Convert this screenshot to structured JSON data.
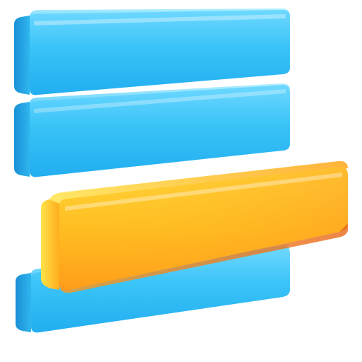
{
  "icon": {
    "name": "sorted-bars-icon",
    "bars": [
      {
        "id": "bar-1",
        "color_name": "blue",
        "highlighted": false
      },
      {
        "id": "bar-2",
        "color_name": "blue",
        "highlighted": false
      },
      {
        "id": "bar-3",
        "color_name": "orange",
        "highlighted": true
      },
      {
        "id": "bar-4",
        "color_name": "blue",
        "highlighted": false
      }
    ],
    "colors": {
      "blue_light": "#7fe0ff",
      "blue_main": "#2bbcf4",
      "blue_dark": "#1a90d8",
      "orange_light": "#ffe14a",
      "orange_main": "#ffb21e",
      "orange_dark": "#f07a14"
    }
  }
}
